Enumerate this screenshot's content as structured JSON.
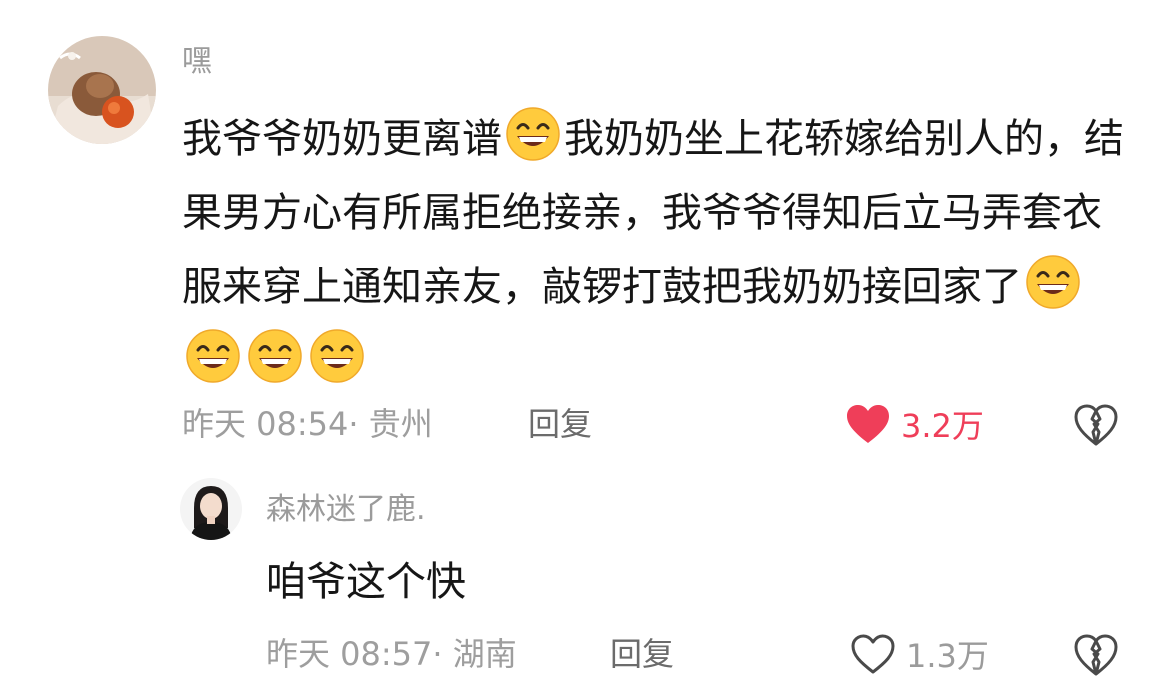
{
  "comment": {
    "username": "嘿",
    "text_part1": "我爷爷奶奶更离谱",
    "text_part2": "我奶奶坐上花轿嫁给别人的，结果男方心有所属拒绝接亲，我爷爷得知后立马弄套衣服来穿上通知亲友，敲锣打鼓把我奶奶接回家了",
    "time": "昨天 08:54",
    "location": "· 贵州",
    "reply_label": "回复",
    "likes": "3.2万",
    "liked": true,
    "emoji_name": "grinning-emoji"
  },
  "reply": {
    "username": "森林迷了鹿.",
    "text": "咱爷这个快",
    "time": "昨天 08:57",
    "location": "· 湖南",
    "reply_label": "回复",
    "likes": "1.3万",
    "liked": false
  },
  "colors": {
    "liked_heart": "#ef3e59",
    "muted_text": "#9e9e9e",
    "body_text": "#161616"
  }
}
